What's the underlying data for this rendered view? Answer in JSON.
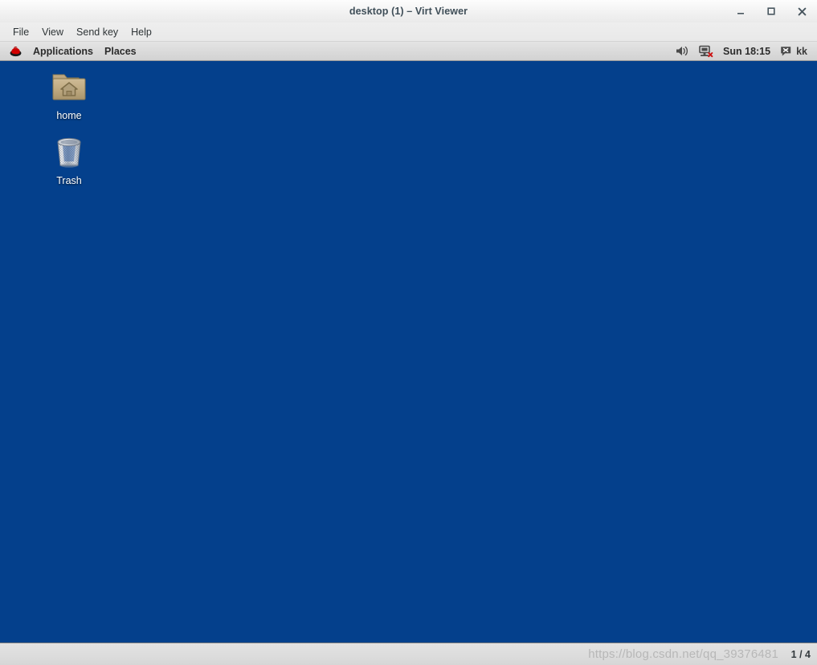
{
  "window": {
    "title": "desktop (1) – Virt Viewer",
    "controls": [
      {
        "name": "minimize",
        "label": "_"
      },
      {
        "name": "maximize",
        "label": "□"
      },
      {
        "name": "close",
        "label": "✕"
      }
    ]
  },
  "menubar": {
    "items": [
      {
        "label": "File"
      },
      {
        "label": "View"
      },
      {
        "label": "Send key"
      },
      {
        "label": "Help"
      }
    ]
  },
  "gnome_panel": {
    "logo_icon": "redhat-shadowman-icon",
    "left_menus": [
      {
        "label": "Applications"
      },
      {
        "label": "Places"
      }
    ],
    "tray": {
      "volume_icon": "volume-speaker-icon",
      "network_icon": "network-disconnected-icon",
      "clock": "Sun 18:15",
      "messaging_icon": "chat-bubble-error-icon",
      "user": "kk"
    }
  },
  "desktop": {
    "background_color": "#04408c",
    "icons": [
      {
        "label": "home",
        "icon": "home-folder-icon"
      },
      {
        "label": "Trash",
        "icon": "trash-can-icon"
      }
    ]
  },
  "statusbar": {
    "page_indicator": "1 / 4"
  },
  "overlay": {
    "watermark": "https://blog.csdn.net/qq_39376481"
  }
}
